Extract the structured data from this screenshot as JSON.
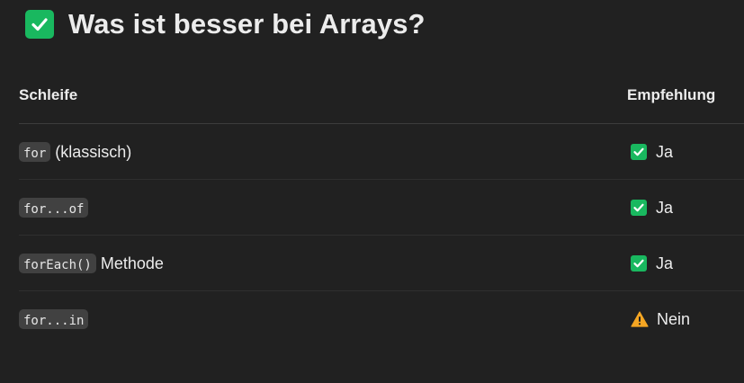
{
  "heading": {
    "icon": "check-mark-button-icon",
    "title": "Was ist besser bei Arrays?"
  },
  "table": {
    "headers": [
      "Schleife",
      "Empfehlung"
    ],
    "rows": [
      {
        "code": "for",
        "description": "(klassisch)",
        "status_icon": "check-mark-button-icon",
        "recommendation": "Ja"
      },
      {
        "code": "for...of",
        "description": "",
        "status_icon": "check-mark-button-icon",
        "recommendation": "Ja"
      },
      {
        "code": "forEach()",
        "description": "Methode",
        "status_icon": "check-mark-button-icon",
        "recommendation": "Ja"
      },
      {
        "code": "for...in",
        "description": "",
        "status_icon": "warning-icon",
        "recommendation": "Nein"
      }
    ]
  },
  "colors": {
    "background": "#212121",
    "text": "#ececec",
    "check_green": "#19b85f",
    "warning_amber": "#f5a623",
    "code_background": "#414141"
  }
}
